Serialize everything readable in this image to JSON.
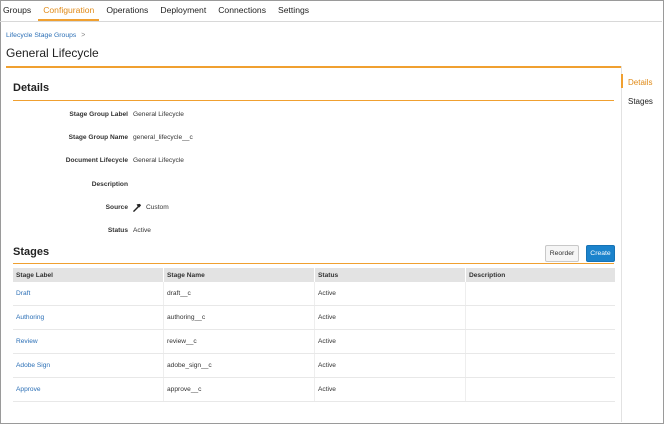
{
  "nav": {
    "items": [
      "Groups",
      "Configuration",
      "Operations",
      "Deployment",
      "Connections",
      "Settings"
    ],
    "active": "Configuration"
  },
  "breadcrumb": {
    "parent": "Lifecycle Stage Groups",
    "separator": ">"
  },
  "page_title": "General Lifecycle",
  "side_nav": {
    "items": [
      "Details",
      "Stages"
    ],
    "active": "Details"
  },
  "details": {
    "heading": "Details",
    "fields": [
      {
        "label": "Stage Group Label",
        "value": "General Lifecycle"
      },
      {
        "label": "Stage Group Name",
        "value": "general_lifecycle__c"
      },
      {
        "label": "Document Lifecycle",
        "value": "General Lifecycle"
      },
      {
        "label": "Description",
        "value": ""
      },
      {
        "label": "Source",
        "value": "Custom",
        "icon": "hammer-icon"
      },
      {
        "label": "Status",
        "value": "Active"
      }
    ]
  },
  "stages": {
    "heading": "Stages",
    "reorder_label": "Reorder",
    "create_label": "Create",
    "columns": [
      "Stage Label",
      "Stage Name",
      "Status",
      "Description"
    ],
    "rows": [
      {
        "label": "Draft",
        "name": "draft__c",
        "status": "Active",
        "description": ""
      },
      {
        "label": "Authoring",
        "name": "authoring__c",
        "status": "Active",
        "description": ""
      },
      {
        "label": "Review",
        "name": "review__c",
        "status": "Active",
        "description": ""
      },
      {
        "label": "Adobe Sign",
        "name": "adobe_sign__c",
        "status": "Active",
        "description": ""
      },
      {
        "label": "Approve",
        "name": "approve__c",
        "status": "Active",
        "description": ""
      }
    ]
  },
  "colors": {
    "accent": "#f0a030",
    "link": "#2b6fb6",
    "primary_button": "#1b83cc"
  }
}
